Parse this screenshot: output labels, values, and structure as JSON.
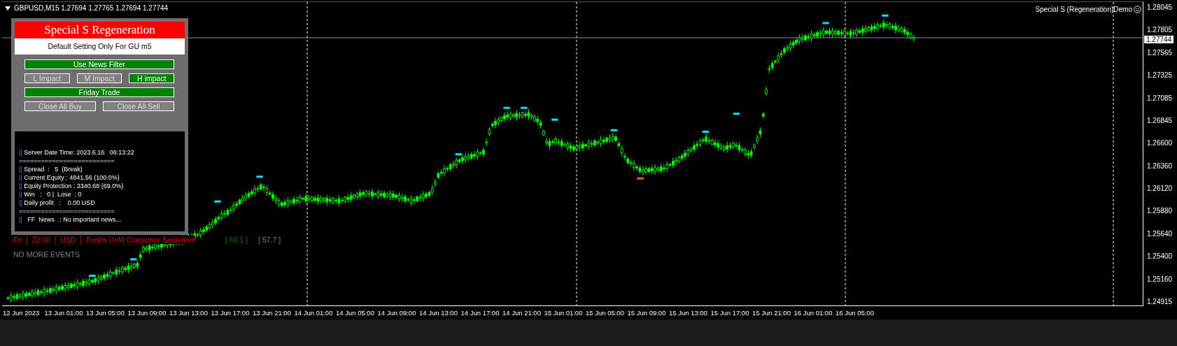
{
  "chart_header": {
    "symbol_info": "GBPUSD,M15  1.27694 1.27765 1.27694 1.27744"
  },
  "indicator_label": "Special S (Regeneration)Demo",
  "panel": {
    "title": "Special S Regeneration",
    "subtitle": "Default Setting Only For GU m5",
    "button_rows": [
      [
        {
          "label": "Use News Filter",
          "kind": "toggle",
          "on": true
        }
      ],
      [
        {
          "label": "L Impact",
          "kind": "toggle",
          "on": false
        },
        {
          "label": "M Impact",
          "kind": "toggle",
          "on": false
        },
        {
          "label": "H impact",
          "kind": "toggle",
          "on": true
        }
      ],
      [
        {
          "label": "Friday Trade",
          "kind": "toggle",
          "on": true
        }
      ],
      [
        {
          "label": "Close All Buy",
          "kind": "action"
        },
        {
          "label": "Close All Sell",
          "kind": "action"
        }
      ]
    ],
    "info_lines": [
      {
        "kind": "line",
        "marker": "||",
        "text": "Server Date Time: 2023.6.16   06:13:22"
      },
      {
        "kind": "rule",
        "text": "=========================="
      },
      {
        "kind": "line",
        "marker": "||",
        "text": "Spread  :   5  (Break)"
      },
      {
        "kind": "line",
        "marker": "||",
        "text": "Current Equity : 4841.56 (100.0%)"
      },
      {
        "kind": "line",
        "marker": "||",
        "text": "Equity Protection : 3340.68 (69.0%)"
      },
      {
        "kind": "line",
        "marker": "||",
        "text": "Win   :   0 |  Lose  : 0"
      },
      {
        "kind": "line",
        "marker": "||",
        "text": "Daily profit   :    0.00 USD"
      },
      {
        "kind": "rule",
        "text": "=========================="
      },
      {
        "kind": "line",
        "marker": "||",
        "text": "  FF  News   : No important news..."
      }
    ]
  },
  "news_event": {
    "text": "Fri  |  22:00  |  USD  |  Prelim UoM Consumer Sentiment",
    "values": [
      {
        "text": "[ 60.1 ]",
        "color": "#008000"
      },
      {
        "text": "[ 57.7 ]",
        "color": "#808080"
      }
    ]
  },
  "news_status": "NO MORE EVENTS",
  "current_price": "1.27744",
  "price_axis": [
    "1.28045",
    "1.27805",
    "1.27565",
    "1.27325",
    "1.27085",
    "1.26845",
    "1.26600",
    "1.26360",
    "1.26120",
    "1.25880",
    "1.25640",
    "1.25400",
    "1.25160",
    "1.24915"
  ],
  "time_axis": [
    "12 Jun 2023",
    "13 Jun 01:00",
    "13 Jun 05:00",
    "13 Jun 09:00",
    "13 Jun 13:00",
    "13 Jun 17:00",
    "13 Jun 21:00",
    "14 Jun 01:00",
    "14 Jun 05:00",
    "14 Jun 09:00",
    "14 Jun 13:00",
    "14 Jun 17:00",
    "14 Jun 21:00",
    "15 Jun 01:00",
    "15 Jun 05:00",
    "15 Jun 09:00",
    "15 Jun 13:00",
    "15 Jun 17:00",
    "15 Jun 21:00",
    "16 Jun 01:00",
    "16 Jun 05:00"
  ]
}
